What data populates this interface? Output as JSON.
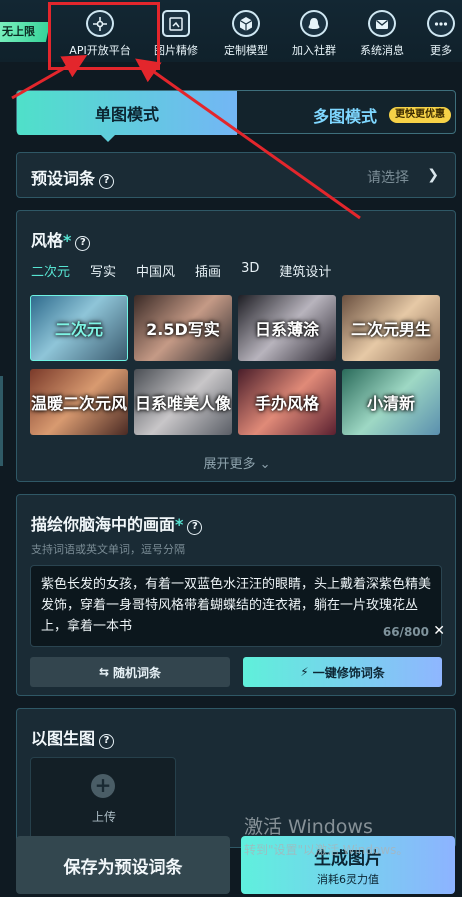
{
  "topnav": {
    "promo_badge": "无上限",
    "items": [
      {
        "label": "API开放平台",
        "icon": "api-network-icon"
      },
      {
        "label": "图片精修",
        "icon": "image-refine-icon"
      },
      {
        "label": "定制模型",
        "icon": "cube-icon"
      },
      {
        "label": "加入社群",
        "icon": "community-icon"
      },
      {
        "label": "系统消息",
        "icon": "mail-icon"
      },
      {
        "label": "更多",
        "icon": "more-dots-icon"
      }
    ]
  },
  "annotation": {
    "color": "#e3262c"
  },
  "mode_tabs": {
    "single": "单图模式",
    "multi": "多图模式",
    "multi_badge": "更快更优惠"
  },
  "preset": {
    "title": "预设词条",
    "placeholder": "请选择"
  },
  "style": {
    "title": "风格",
    "tabs": [
      "二次元",
      "写实",
      "中国风",
      "插画",
      "3D",
      "建筑设计"
    ],
    "active_tab": "二次元",
    "thumbnails": [
      {
        "label": "二次元",
        "selected": true
      },
      {
        "label": "2.5D写实",
        "selected": false
      },
      {
        "label": "日系薄涂",
        "selected": false
      },
      {
        "label": "二次元男生",
        "selected": false
      },
      {
        "label": "温暖二次元风",
        "selected": false
      },
      {
        "label": "日系唯美人像",
        "selected": false
      },
      {
        "label": "手办风格",
        "selected": false
      },
      {
        "label": "小清新",
        "selected": false
      }
    ],
    "expand_label": "展开更多"
  },
  "describe": {
    "title": "描绘你脑海中的画面",
    "hint": "支持词语或英文单词，逗号分隔",
    "prompt_text": "紫色长发的女孩，有着一双蓝色水汪汪的眼睛，头上戴着深紫色精美发饰，穿着一身哥特风格带着蝴蝶结的连衣裙，躺在一片玫瑰花丛上，拿着一本书",
    "counter": "66/800",
    "random_button": "随机词条",
    "polish_button": "一键修饰词条"
  },
  "img2img": {
    "title": "以图生图",
    "upload_label": "上传"
  },
  "watermark": {
    "title": "激活 Windows",
    "subtitle": "转到\"设置\"以激活 Windows。"
  },
  "bottom": {
    "save_button": "保存为预设词条",
    "generate_button": "生成图片",
    "generate_cost": "消耗6灵力值"
  }
}
